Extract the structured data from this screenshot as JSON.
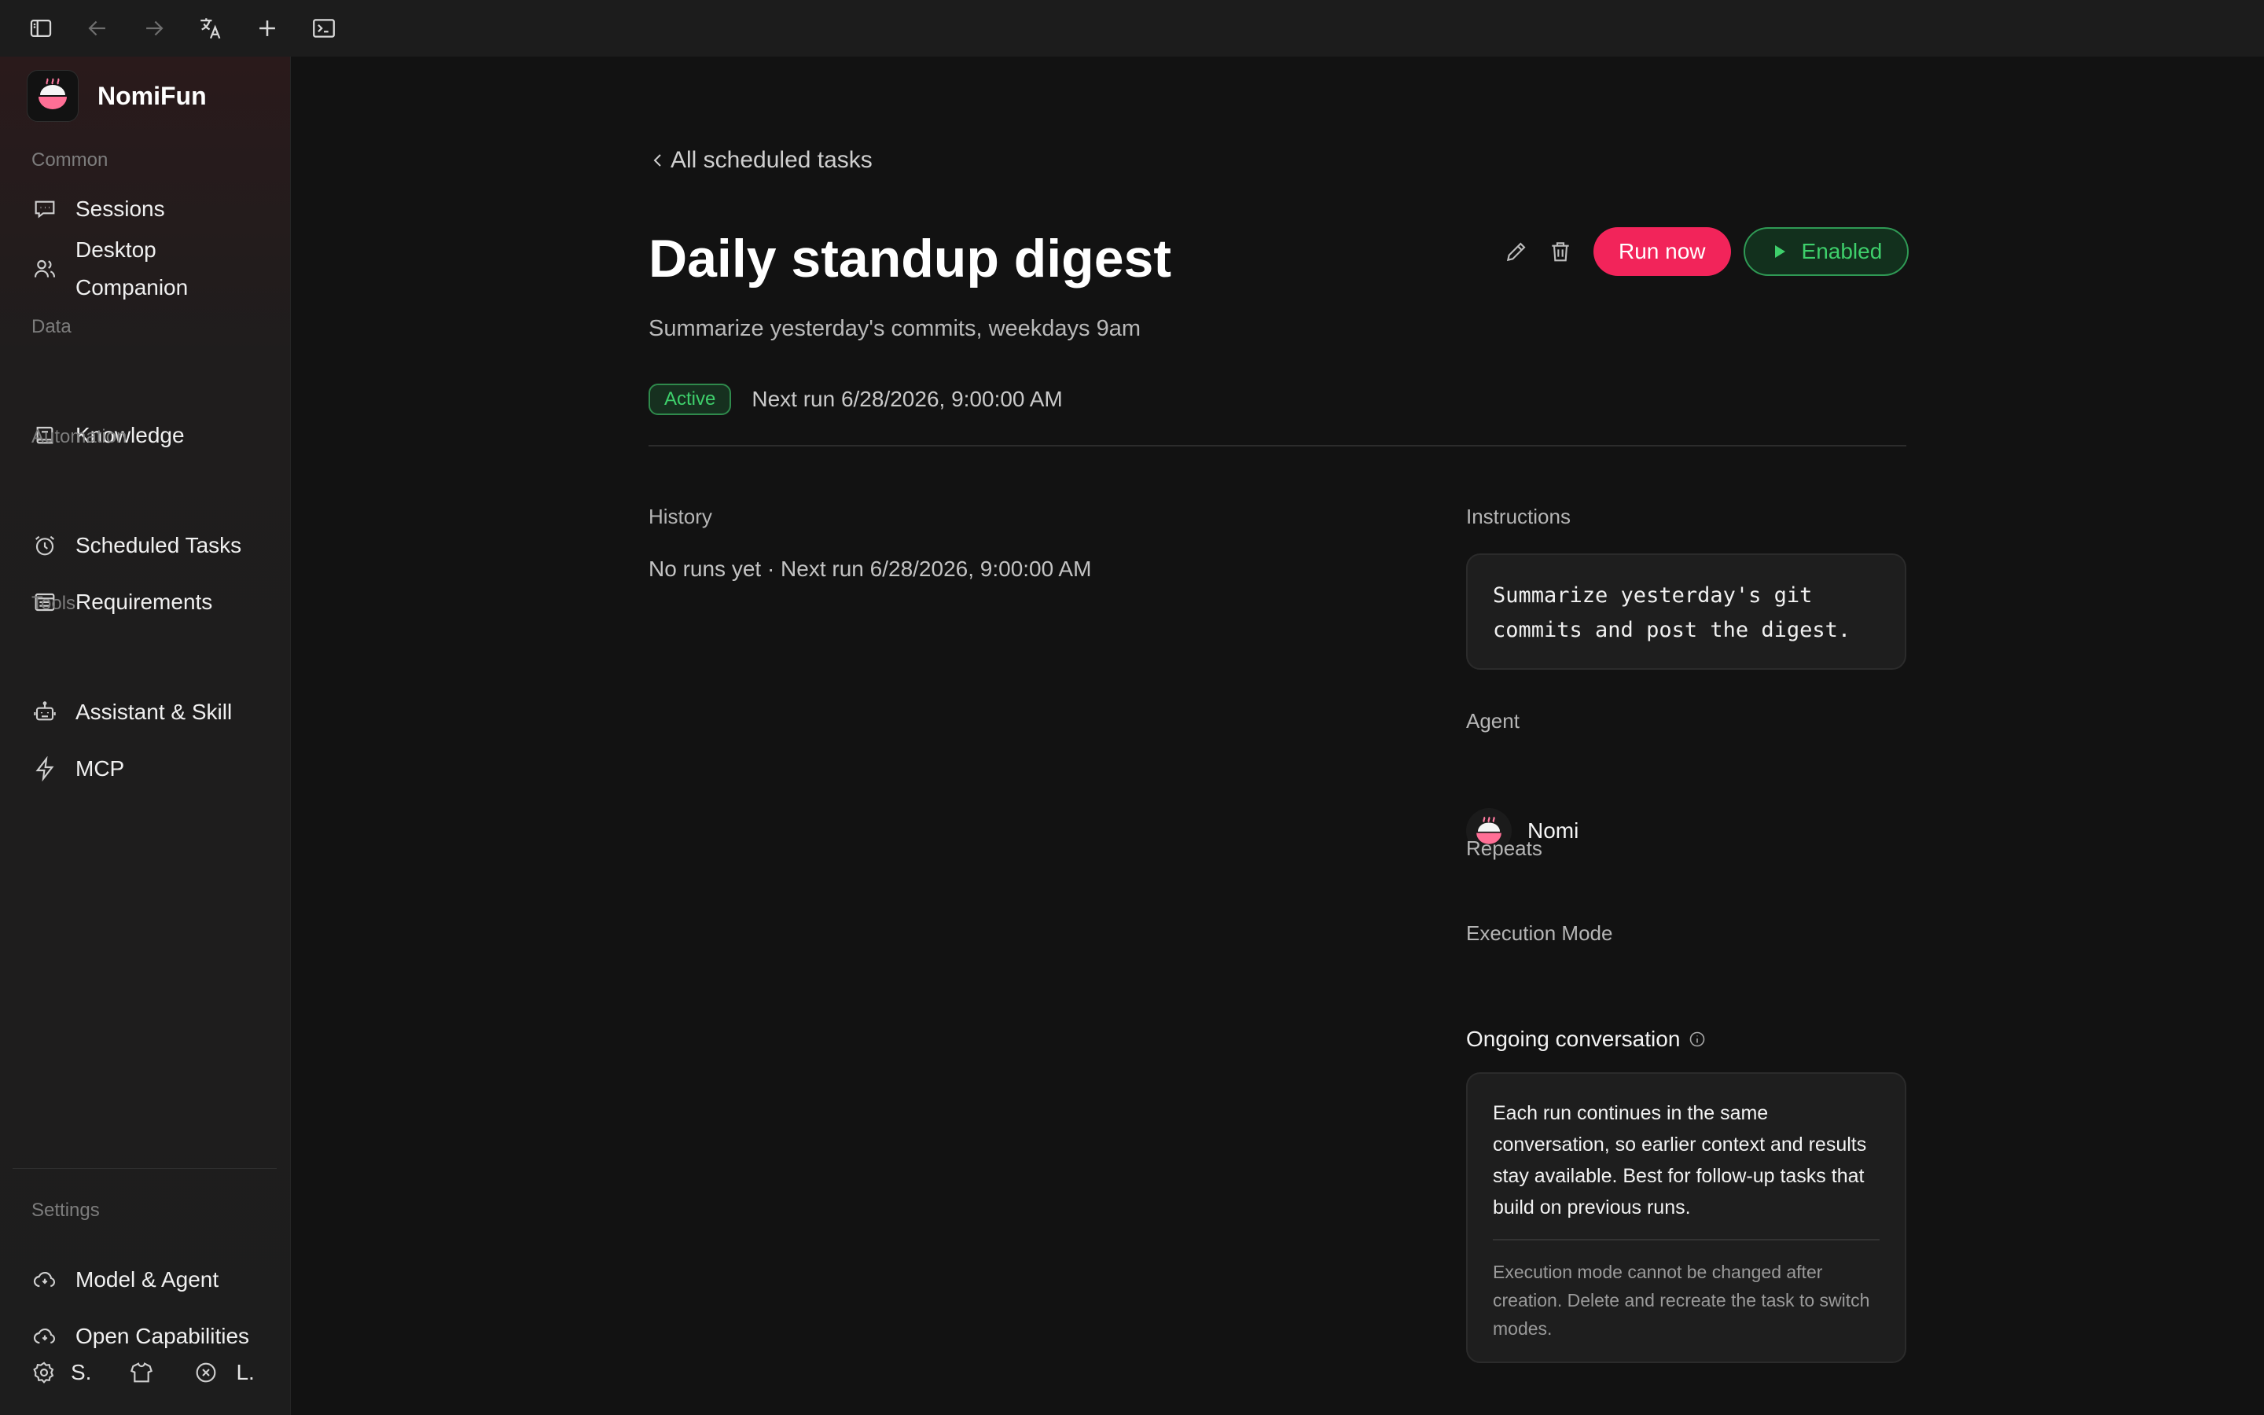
{
  "app": {
    "name": "NomiFun"
  },
  "sidebar": {
    "sections": {
      "common": "Common",
      "data": "Data",
      "automation": "Automation",
      "tools": "Tools",
      "settings": "Settings"
    },
    "items": {
      "sessions": "Sessions",
      "desktop": "Desktop",
      "companion": "Companion",
      "knowledge": "Knowledge",
      "scheduled_tasks": "Scheduled Tasks",
      "requirements": "Requirements",
      "assistant_skill": "Assistant & Skill",
      "mcp": "MCP",
      "model_agent": "Model & Agent",
      "open_capabilities": "Open Capabilities"
    },
    "bottom": {
      "settings_short": "S.",
      "language_short": "L."
    }
  },
  "main": {
    "back_link": "All scheduled tasks",
    "title": "Daily standup digest",
    "subtitle": "Summarize yesterday's commits, weekdays 9am",
    "status_badge": "Active",
    "next_run": "Next run 6/28/2026, 9:00:00 AM",
    "run_now": "Run now",
    "enabled": "Enabled",
    "history_label": "History",
    "history_text": "No runs yet · Next run 6/28/2026, 9:00:00 AM",
    "instructions_label": "Instructions",
    "instructions_line1": "Summarize yesterday's git",
    "instructions_line2": "commits and post the digest.",
    "agent_label": "Agent",
    "agent_name": "Nomi",
    "repeats_label": "Repeats",
    "execution_mode_label": "Execution Mode",
    "execution_mode_value": "Ongoing conversation",
    "mode_description": "Each run continues in the same conversation, so earlier context and results stay available. Best for follow-up tasks that build on previous runs.",
    "mode_note": "Execution mode cannot be changed after creation. Delete and recreate the task to switch modes."
  },
  "colors": {
    "accent": "#f2245a",
    "success": "#3ecf6b",
    "background": "#121212",
    "sidebar": "#1d1d1d"
  }
}
